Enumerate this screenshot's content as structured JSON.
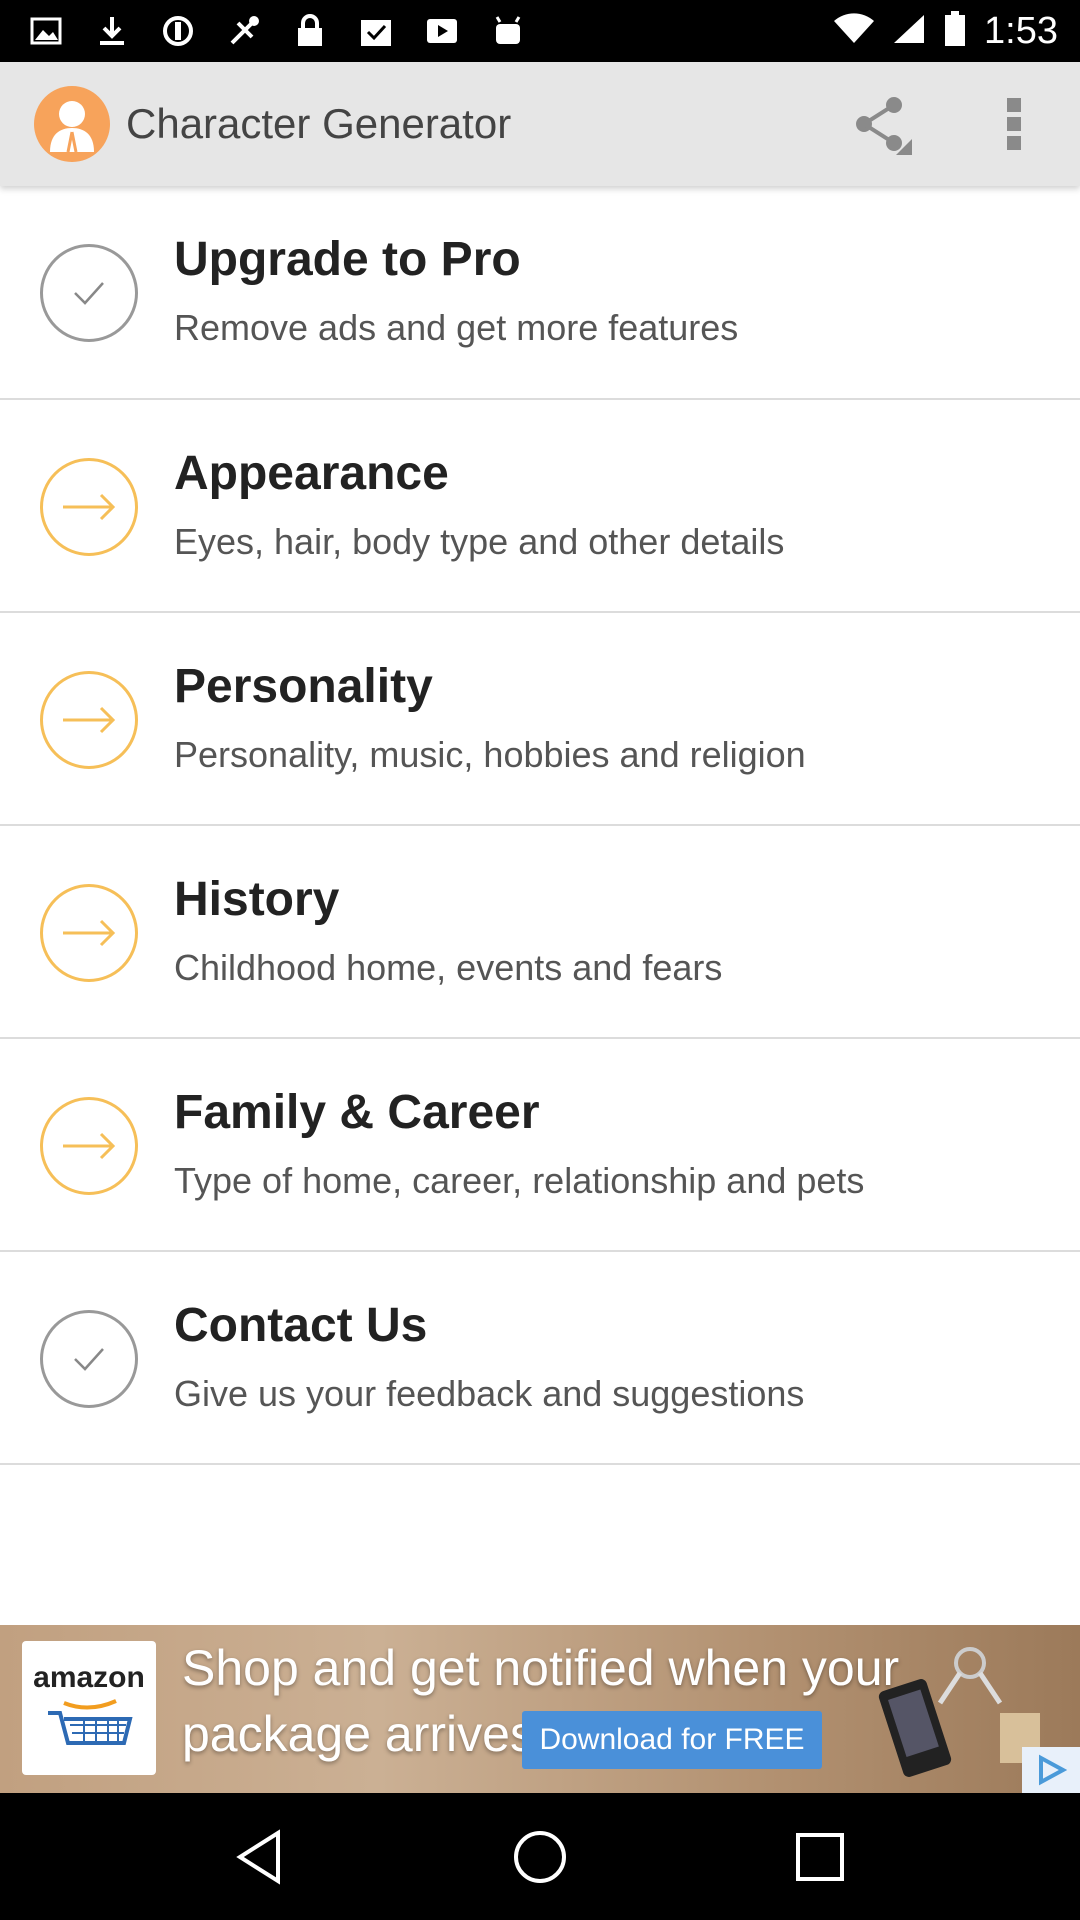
{
  "status_bar": {
    "time": "1:53",
    "icons": [
      "image-icon",
      "download-icon",
      "blocked-icon",
      "fake-gps-icon",
      "lock-icon",
      "clipboard-icon",
      "video-icon",
      "android-icon"
    ]
  },
  "app_bar": {
    "title": "Character Generator",
    "logo_icon": "person-avatar-icon",
    "accent_color": "#f7a35b"
  },
  "menu": {
    "items": [
      {
        "title": "Upgrade to Pro",
        "subtitle": "Remove ads and get more features",
        "icon": "check-icon"
      },
      {
        "title": "Appearance",
        "subtitle": "Eyes, hair, body type and other details",
        "icon": "arrow-right-icon"
      },
      {
        "title": "Personality",
        "subtitle": "Personality, music, hobbies and religion",
        "icon": "arrow-right-icon"
      },
      {
        "title": "History",
        "subtitle": "Childhood home, events and fears",
        "icon": "arrow-right-icon"
      },
      {
        "title": "Family & Career",
        "subtitle": "Type of home, career, relationship and pets",
        "icon": "arrow-right-icon"
      },
      {
        "title": "Contact Us",
        "subtitle": "Give us your feedback and suggestions",
        "icon": "check-icon"
      }
    ]
  },
  "ad": {
    "brand": "amazon",
    "line1": "Shop and get notified when your",
    "line2": "package arrives",
    "cta": "Download for FREE"
  },
  "nav_bar": {
    "buttons": [
      "back-icon",
      "home-icon",
      "recents-icon"
    ]
  }
}
